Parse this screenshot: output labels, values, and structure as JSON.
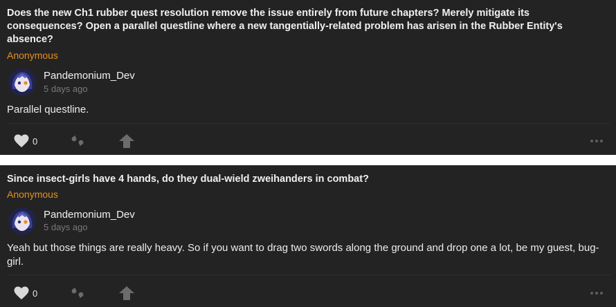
{
  "posts": [
    {
      "question": "Does the new Ch1 rubber quest resolution remove the issue entirely from future chapters? Merely mitigate its consequences? Open a parallel questline where a new tangentially-related problem has arisen in the Rubber Entity's absence?",
      "asker": "Anonymous",
      "author": "Pandemonium_Dev",
      "time": "5 days ago",
      "answer": "Parallel questline.",
      "likes": "0"
    },
    {
      "question": "Since insect-girls have 4 hands, do they dual-wield zweihanders in combat?",
      "asker": "Anonymous",
      "author": "Pandemonium_Dev",
      "time": "5 days ago",
      "answer": "Yeah but those things are really heavy. So if you want to drag two swords along the ground and drop one a lot, be my guest, bug-girl.",
      "likes": "0"
    }
  ],
  "icons": {
    "like": "heart-icon",
    "quote": "quote-icon",
    "share": "share-arrow-icon",
    "more": "more-dots-icon",
    "avatar": "avatar"
  },
  "colors": {
    "card_bg": "#232323",
    "asker": "#e8901e",
    "muted": "#7a7a7a"
  }
}
